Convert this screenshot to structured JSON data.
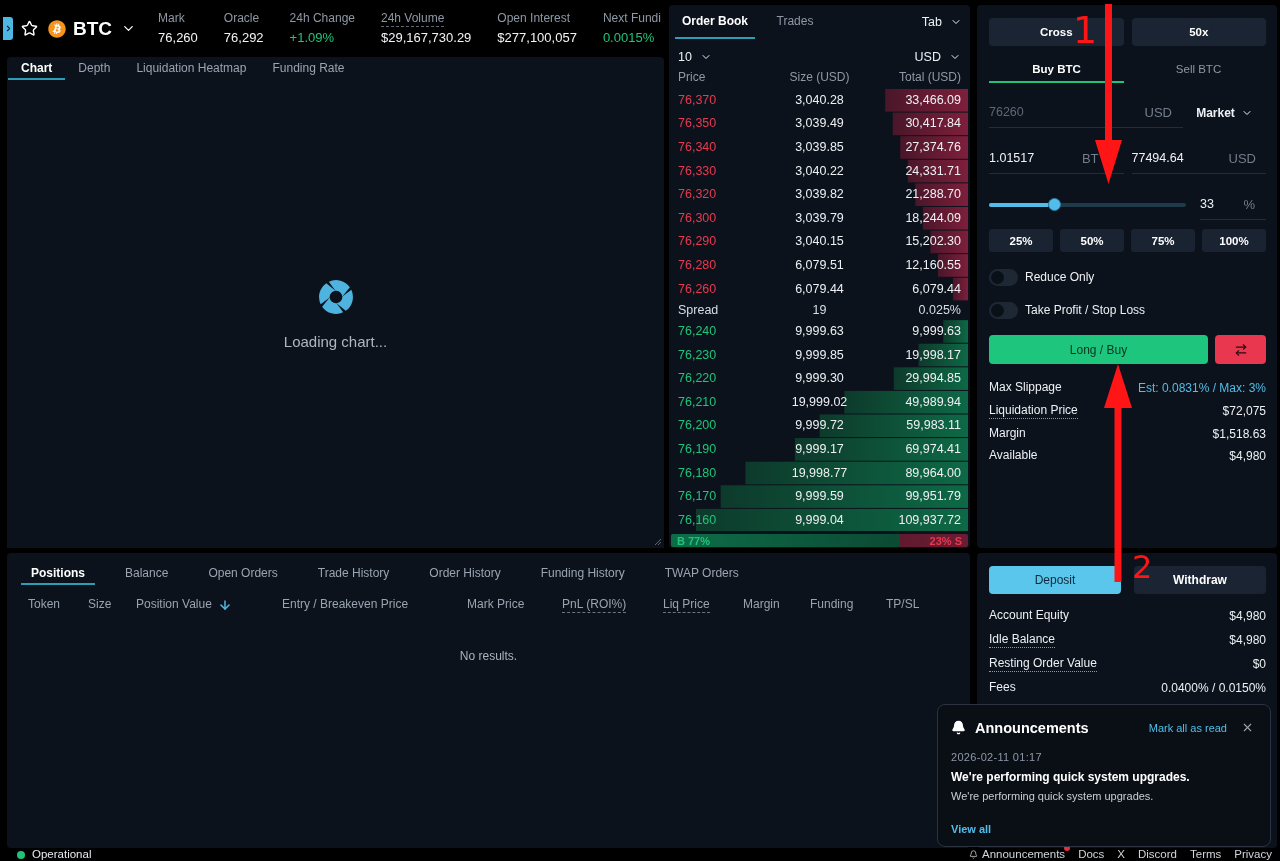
{
  "top_bar": {
    "symbol": "BTC",
    "favorite": false,
    "stats": [
      {
        "label": "Mark",
        "value": "76,260",
        "dotted": false,
        "positive": false
      },
      {
        "label": "Oracle",
        "value": "76,292",
        "dotted": false,
        "positive": false
      },
      {
        "label": "24h Change",
        "value": "+1.09%",
        "dotted": false,
        "positive": true
      },
      {
        "label": "24h Volume",
        "value": "$29,167,730.29",
        "dotted": true,
        "positive": false
      },
      {
        "label": "Open Interest",
        "value": "$277,100,057",
        "dotted": false,
        "positive": false
      },
      {
        "label": "Next Fundi",
        "value": "0.0015%",
        "dotted": false,
        "positive": true
      }
    ]
  },
  "chart_panel": {
    "tabs": [
      {
        "label": "Chart",
        "selected": true
      },
      {
        "label": "Depth",
        "selected": false
      },
      {
        "label": "Liquidation Heatmap",
        "selected": false
      },
      {
        "label": "Funding Rate",
        "selected": false
      }
    ],
    "loading_text": "Loading chart..."
  },
  "order_book": {
    "tabs": [
      {
        "label": "Order Book",
        "selected": true
      },
      {
        "label": "Trades",
        "selected": false
      }
    ],
    "view_menu": "Tab",
    "grouping": "10",
    "currency": "USD",
    "columns": [
      "Price",
      "Size (USD)",
      "Total (USD)"
    ],
    "asks": [
      {
        "price": "76,370",
        "size": "3,040.28",
        "total": "33,466.09"
      },
      {
        "price": "76,350",
        "size": "3,039.49",
        "total": "30,417.84"
      },
      {
        "price": "76,340",
        "size": "3,039.85",
        "total": "27,374.76"
      },
      {
        "price": "76,330",
        "size": "3,040.22",
        "total": "24,331.71"
      },
      {
        "price": "76,320",
        "size": "3,039.82",
        "total": "21,288.70"
      },
      {
        "price": "76,300",
        "size": "3,039.79",
        "total": "18,244.09"
      },
      {
        "price": "76,290",
        "size": "3,040.15",
        "total": "15,202.30"
      },
      {
        "price": "76,280",
        "size": "6,079.51",
        "total": "12,160.55"
      },
      {
        "price": "76,260",
        "size": "6,079.44",
        "total": "6,079.44"
      }
    ],
    "spread": {
      "label": "Spread",
      "value": "19",
      "percent": "0.025%"
    },
    "bids": [
      {
        "price": "76,240",
        "size": "9,999.63",
        "total": "9,999.63"
      },
      {
        "price": "76,230",
        "size": "9,999.85",
        "total": "19,998.17"
      },
      {
        "price": "76,220",
        "size": "9,999.30",
        "total": "29,994.85"
      },
      {
        "price": "76,210",
        "size": "19,999.02",
        "total": "49,989.94"
      },
      {
        "price": "76,200",
        "size": "9,999.72",
        "total": "59,983.11"
      },
      {
        "price": "76,190",
        "size": "9,999.17",
        "total": "69,974.41"
      },
      {
        "price": "76,180",
        "size": "19,998.77",
        "total": "89,964.00"
      },
      {
        "price": "76,170",
        "size": "9,999.59",
        "total": "99,951.79"
      },
      {
        "price": "76,160",
        "size": "9,999.04",
        "total": "109,937.72"
      }
    ],
    "ratio": {
      "buy_label": "B 77%",
      "sell_label": "23% S",
      "level": 0.77
    }
  },
  "order_form": {
    "margin_mode": "Cross",
    "leverage": "50x",
    "sides": [
      {
        "label": "Buy BTC",
        "selected": true
      },
      {
        "label": "Sell BTC",
        "selected": false
      }
    ],
    "price": {
      "placeholder": "76260",
      "unit": "USD"
    },
    "order_type": "Market",
    "size": {
      "value": "1.01517",
      "unit": "BT"
    },
    "notional": {
      "value": "77494.64",
      "unit": "USD"
    },
    "slider": {
      "level": 0.33,
      "value": "33",
      "unit": "%"
    },
    "presets": [
      "25%",
      "50%",
      "75%",
      "100%"
    ],
    "toggles": [
      {
        "label": "Reduce Only",
        "on": false
      },
      {
        "label": "Take Profit / Stop Loss",
        "on": false
      }
    ],
    "submit": "Long / Buy",
    "details": [
      {
        "label": "Max Slippage",
        "value": "Est: 0.0831% / Max: 3%",
        "dotted": false,
        "accent": true
      },
      {
        "label": "Liquidation Price",
        "value": "$72,075",
        "dotted": true,
        "accent": false
      },
      {
        "label": "Margin",
        "value": "$1,518.63",
        "dotted": false,
        "accent": false
      },
      {
        "label": "Available",
        "value": "$4,980",
        "dotted": false,
        "accent": false
      }
    ]
  },
  "positions": {
    "tabs": [
      {
        "label": "Positions",
        "selected": true
      },
      {
        "label": "Balance",
        "selected": false
      },
      {
        "label": "Open Orders",
        "selected": false
      },
      {
        "label": "Trade History",
        "selected": false
      },
      {
        "label": "Order History",
        "selected": false
      },
      {
        "label": "Funding History",
        "selected": false
      },
      {
        "label": "TWAP Orders",
        "selected": false
      }
    ],
    "columns": [
      {
        "label": "Token",
        "dotted": false,
        "sorted": false
      },
      {
        "label": "Size",
        "dotted": false,
        "sorted": false
      },
      {
        "label": "Position Value",
        "dotted": false,
        "sorted": true
      },
      {
        "label": "Entry / Breakeven Price",
        "dotted": false,
        "sorted": false
      },
      {
        "label": "Mark Price",
        "dotted": false,
        "sorted": false
      },
      {
        "label": "PnL (ROI%)",
        "dotted": true,
        "sorted": false
      },
      {
        "label": "Liq Price",
        "dotted": true,
        "sorted": false
      },
      {
        "label": "Margin",
        "dotted": false,
        "sorted": false
      },
      {
        "label": "Funding",
        "dotted": false,
        "sorted": false
      },
      {
        "label": "TP/SL",
        "dotted": false,
        "sorted": false
      }
    ],
    "empty_text": "No results."
  },
  "account": {
    "actions": [
      {
        "label": "Deposit",
        "primary": true
      },
      {
        "label": "Withdraw",
        "primary": false
      }
    ],
    "rows": [
      {
        "label": "Account Equity",
        "value": "$4,980",
        "dotted": false
      },
      {
        "label": "Idle Balance",
        "value": "$4,980",
        "dotted": true
      },
      {
        "label": "Resting Order Value",
        "value": "$0",
        "dotted": true
      },
      {
        "label": "Fees",
        "value": "0.0400% / 0.0150%",
        "dotted": false
      }
    ]
  },
  "announcement_popup": {
    "title": "Announcements",
    "mark_read": "Mark all as read",
    "date": "2026-02-11 01:17",
    "headline": "We're performing quick system upgrades.",
    "body": "We're performing quick system upgrades.",
    "view_all": "View all"
  },
  "footer": {
    "status": "Operational",
    "links": [
      {
        "label": "Announcements",
        "kind": "announcements",
        "unread": true
      },
      {
        "label": "Docs",
        "kind": "link",
        "unread": false
      },
      {
        "label": "X",
        "kind": "link",
        "unread": false
      },
      {
        "label": "Discord",
        "kind": "link",
        "unread": false
      },
      {
        "label": "Terms",
        "kind": "link",
        "unread": false
      },
      {
        "label": "Privacy",
        "kind": "link",
        "unread": false
      }
    ]
  },
  "annotations": [
    {
      "label": "1"
    },
    {
      "label": "2"
    }
  ]
}
